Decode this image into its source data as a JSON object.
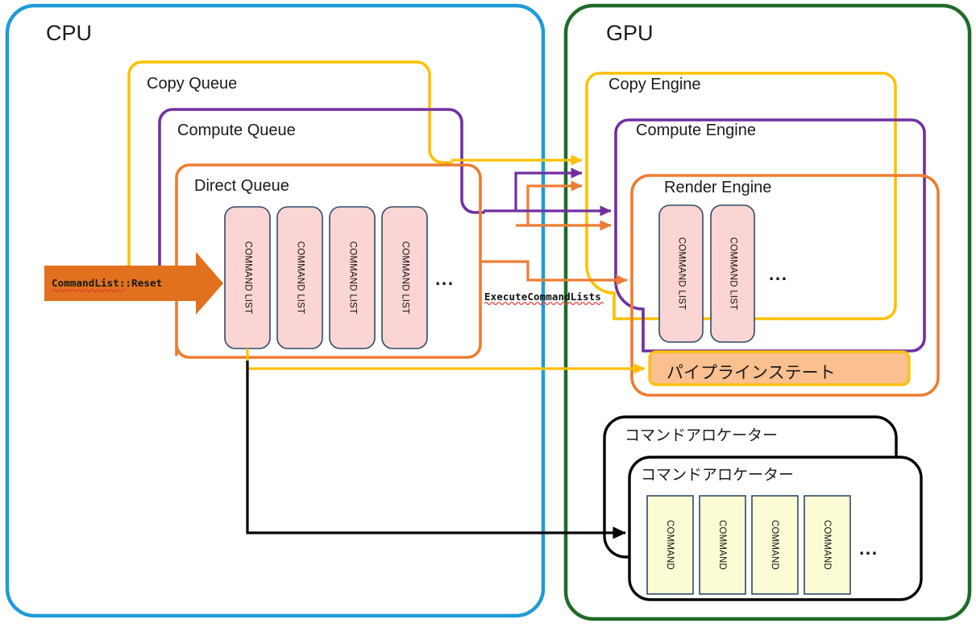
{
  "diagram": {
    "title_semantic": "Direct3D12 CPU/GPU command submission diagram",
    "cpu": {
      "label": "CPU",
      "border_color": "#1f9bd8",
      "queues": [
        {
          "name": "copy-queue",
          "label": "Copy Queue",
          "color": "#ffc000"
        },
        {
          "name": "compute-queue",
          "label": "Compute Queue",
          "color": "#7030a0"
        },
        {
          "name": "direct-queue",
          "label": "Direct Queue",
          "color": "#ed7d31"
        }
      ],
      "command_lists": [
        {
          "label": "COMMAND LIST"
        },
        {
          "label": "COMMAND LIST"
        },
        {
          "label": "COMMAND LIST"
        },
        {
          "label": "COMMAND LIST"
        }
      ],
      "command_lists_more": "...",
      "reset_call": {
        "label": "CommandList::Reset",
        "color": "#e2711d",
        "text_color": "#1a1a1a"
      }
    },
    "gpu": {
      "label": "GPU",
      "border_color": "#1f6b28",
      "engines": [
        {
          "name": "copy-engine",
          "label": "Copy Engine",
          "color": "#ffc000"
        },
        {
          "name": "compute-engine",
          "label": "Compute Engine",
          "color": "#7030a0"
        },
        {
          "name": "render-engine",
          "label": "Render Engine",
          "color": "#ed7d31"
        }
      ],
      "command_lists": [
        {
          "label": "COMMAND LIST"
        },
        {
          "label": "COMMAND LIST"
        }
      ],
      "command_lists_more": "...",
      "pipeline_state": {
        "label": "パイプラインステート",
        "fill": "#fac090",
        "border": "#ffc000"
      },
      "allocators": [
        {
          "label": "コマンドアロケーター"
        },
        {
          "label": "コマンドアロケーター"
        }
      ],
      "commands": [
        {
          "label": "COMMAND"
        },
        {
          "label": "COMMAND"
        },
        {
          "label": "COMMAND"
        },
        {
          "label": "COMMAND"
        }
      ],
      "commands_more": "..."
    },
    "connectors": {
      "execute_call": {
        "label": "ExecuteCommandLists",
        "color": "#111111"
      }
    },
    "palette": {
      "cpu_blue": "#1f9bd8",
      "gpu_green": "#1f6b28",
      "copy_yellow": "#ffc000",
      "compute_purple": "#7030a0",
      "direct_orange": "#ed7d31",
      "reset_arrow": "#e2711d",
      "chip_fill": "#fbd4d4",
      "chip_border": "#2e4b6b",
      "command_fill": "#fbfbd4",
      "command_border": "#2e4b6b",
      "black": "#000000"
    }
  }
}
